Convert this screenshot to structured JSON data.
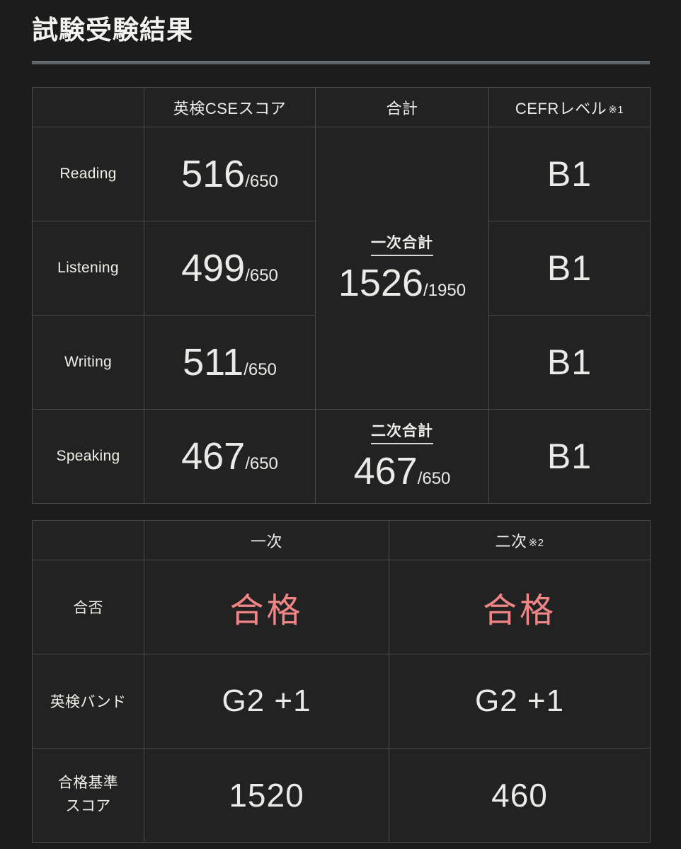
{
  "page": {
    "title": "試験受験結果"
  },
  "score_table": {
    "headers": {
      "corner": "",
      "cse_score": "英検CSEスコア",
      "total": "合計",
      "cefr": "CEFRレベル",
      "cefr_note": "※1"
    },
    "rows": [
      {
        "skill": "Reading",
        "score": "516",
        "denominator": "/650",
        "cefr": "B1"
      },
      {
        "skill": "Listening",
        "score": "499",
        "denominator": "/650",
        "cefr": "B1"
      },
      {
        "skill": "Writing",
        "score": "511",
        "denominator": "/650",
        "cefr": "B1"
      },
      {
        "skill": "Speaking",
        "score": "467",
        "denominator": "/650",
        "cefr": "B1"
      }
    ],
    "totals": {
      "first_stage_label": "一次合計",
      "first_stage_value": "1526",
      "first_stage_denominator": "/1950",
      "second_stage_label": "二次合計",
      "second_stage_value": "467",
      "second_stage_denominator": "/650"
    }
  },
  "result_table": {
    "headers": {
      "corner": "",
      "first_stage": "一次",
      "second_stage": "二次",
      "second_stage_note": "※2"
    },
    "rows": [
      {
        "label": "合否",
        "label_line2": "",
        "first": "合格",
        "second": "合格"
      },
      {
        "label": "英検バンド",
        "label_line2": "",
        "first": "G2 +1",
        "second": "G2 +1"
      },
      {
        "label": "合格基準",
        "label_line2": "スコア",
        "first": "1520",
        "second": "460"
      }
    ]
  },
  "colors": {
    "page_background": "#1c1c1c",
    "cell_background": "#222222",
    "row_label_background": "#27230a",
    "grid_line": "#4a4a4a",
    "text": "#eceae6",
    "pass_red": "#ef8585",
    "rule": "#5c616a"
  }
}
